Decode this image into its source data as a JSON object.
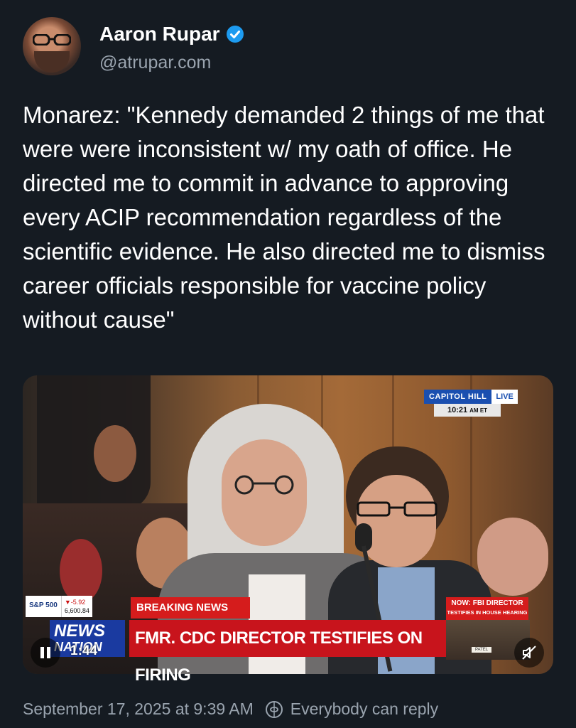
{
  "author": {
    "name": "Aaron Rupar",
    "handle": "@atrupar.com",
    "verified_icon": "verified-badge-icon",
    "accent": "#1d9bf0"
  },
  "post": {
    "text": "Monarez: \"Kennedy demanded 2 things of me that were were inconsistent w/ my oath of office. He directed me to commit in advance to approving every ACIP recommendation regardless of the scientific evidence. He also directed me to dismiss career officials responsible for vaccine policy without cause\""
  },
  "video": {
    "location_label": "CAPITOL HILL",
    "live_label": "LIVE",
    "time": "10:21",
    "time_suffix": "AM ET",
    "ticker_label": "S&P 500",
    "ticker_change": "-5.92",
    "ticker_value": "6,600.84",
    "breaking_label": "BREAKING NEWS",
    "now_line1": "NOW: FBI DIRECTOR",
    "now_line2": "TESTIFIES IN HOUSE HEARING",
    "network_line1": "NEWS",
    "network_line2": "NATION",
    "headline": "FMR. CDC DIRECTOR TESTIFIES ON FIRING",
    "nameplate": "PATEL",
    "timecode": "1:44",
    "play_icon": "pause-icon",
    "mute_icon": "muted-speaker-icon",
    "brand_red": "#d51c1c",
    "brand_blue": "#1a3aa0"
  },
  "footer": {
    "date": "September 17, 2025 at 9:39 AM",
    "reply_setting": "Everybody can reply",
    "reply_icon": "globe-reply-icon"
  }
}
